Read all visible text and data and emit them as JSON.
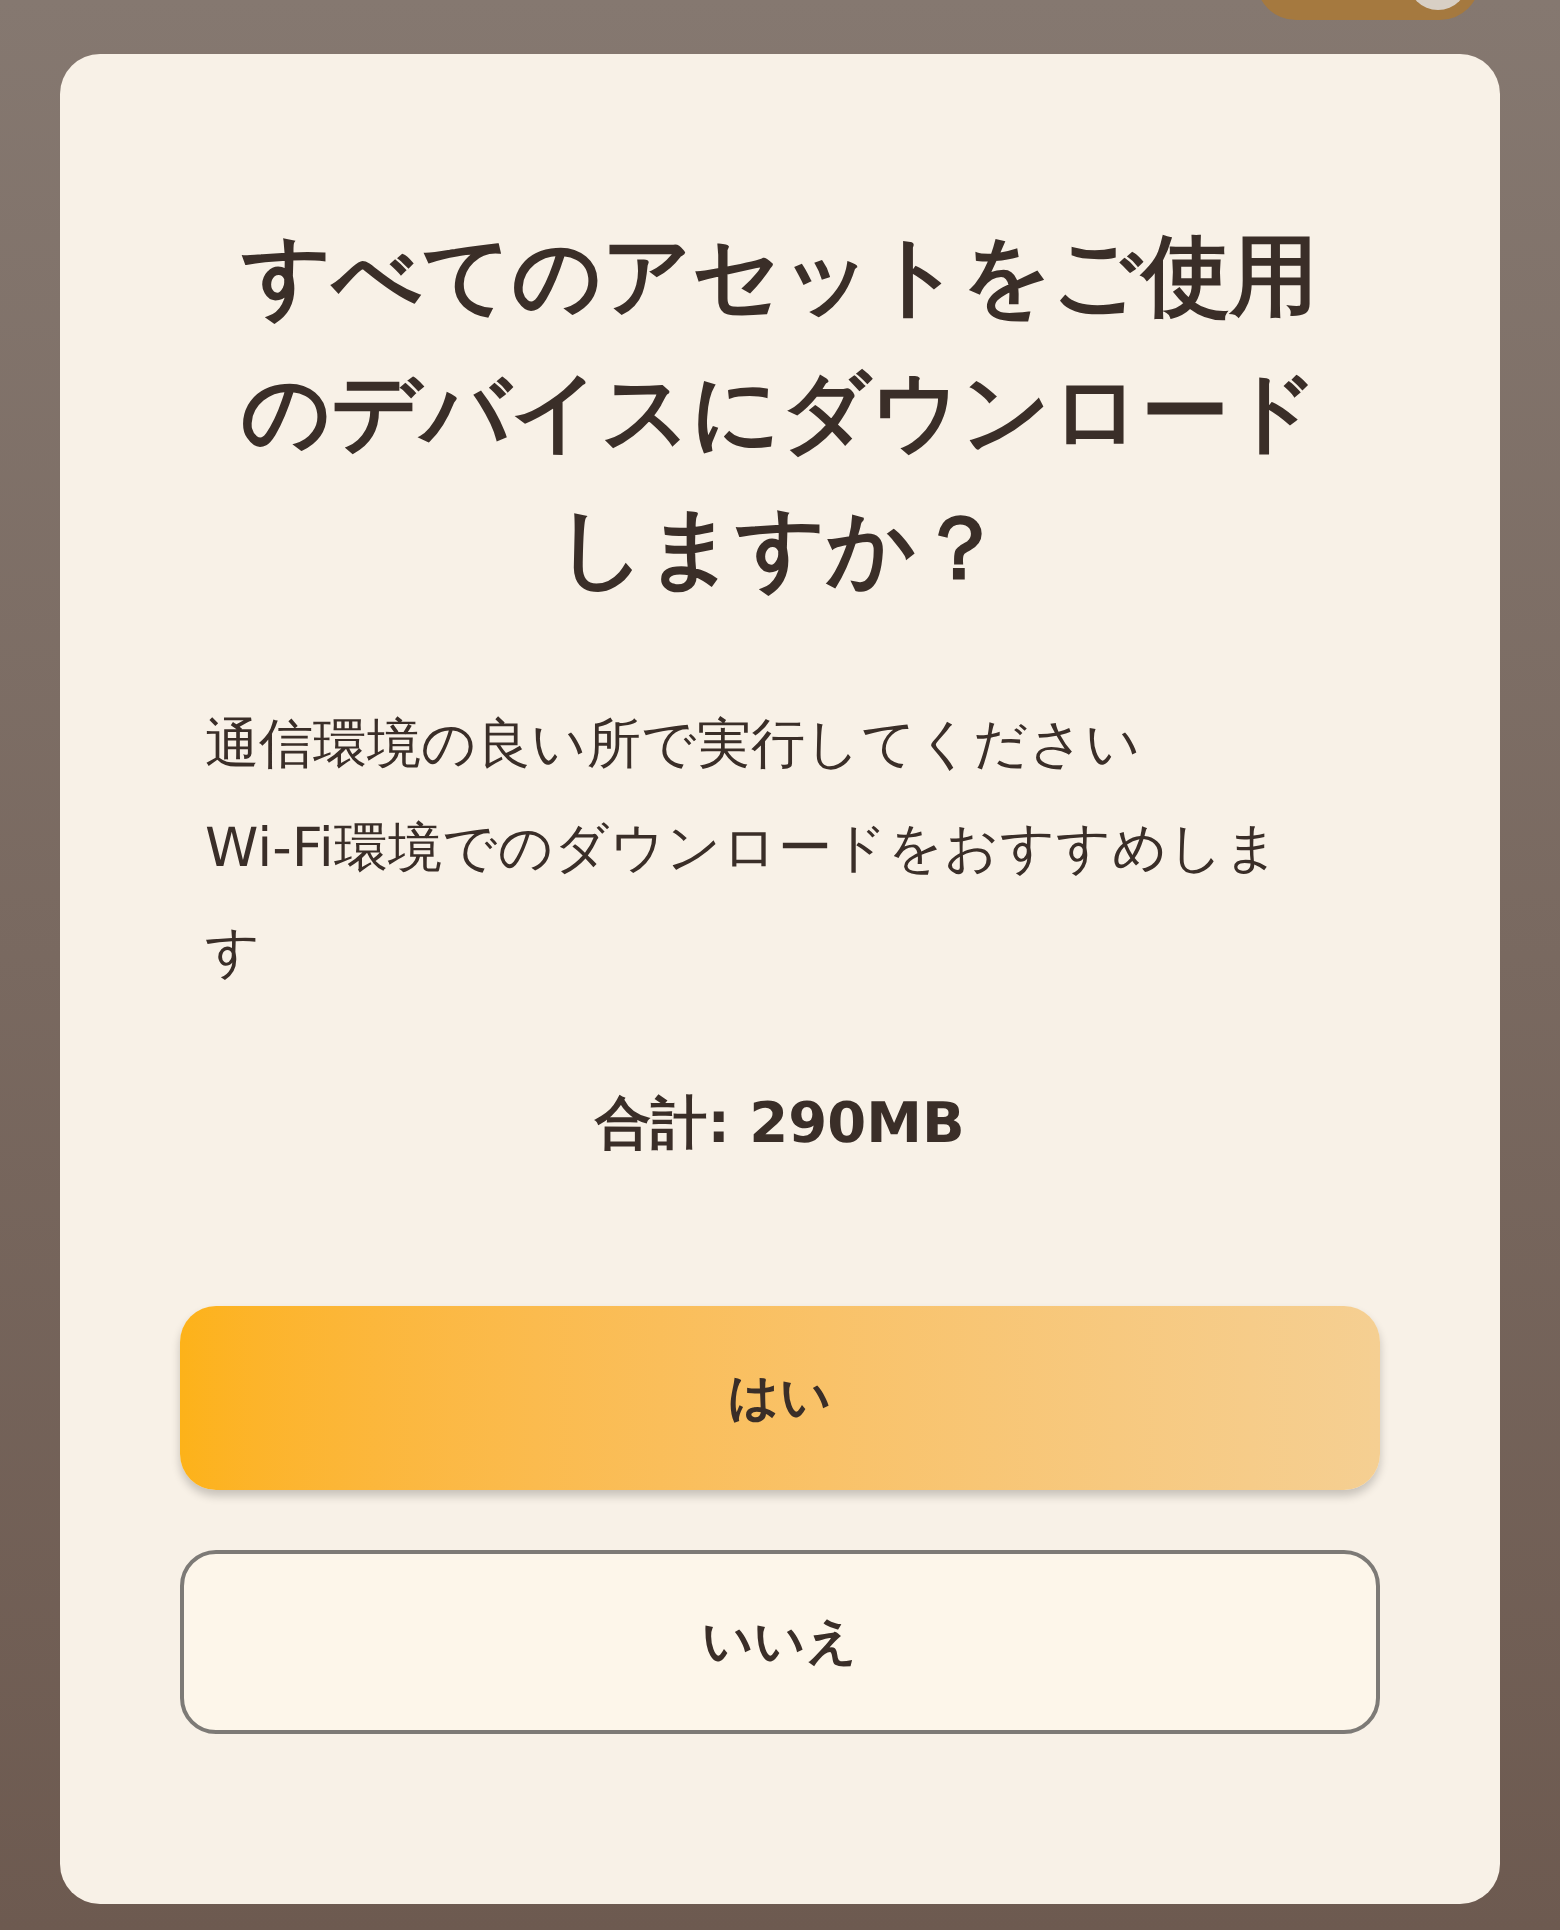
{
  "background_switch": {
    "on": true
  },
  "dialog": {
    "title": "すべてのアセットをご使用のデバイスにダウンロードしますか？",
    "messages": [
      "通信環境の良い所で実行してください",
      "Wi-Fi環境でのダウンロードをおすすめします"
    ],
    "total": "合計: 290MB",
    "buttons": [
      {
        "label": "はい",
        "kind": "primary"
      },
      {
        "label": "いいえ",
        "kind": "secondary"
      }
    ]
  }
}
